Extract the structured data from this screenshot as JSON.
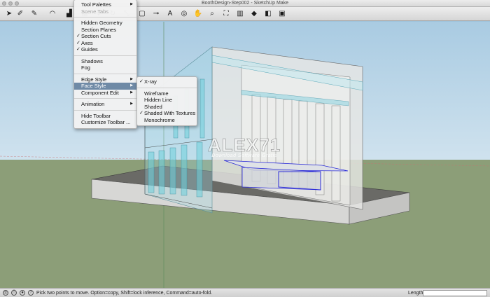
{
  "window": {
    "title": "BoothDesign-Step002 - SketchUp Make"
  },
  "toolbar": {
    "tools": [
      {
        "icon": "select-arrow-icon",
        "glyph": "➤"
      },
      {
        "icon": "eraser-icon",
        "glyph": "✐"
      },
      {
        "icon": "pencil-icon",
        "glyph": "✎"
      },
      {
        "icon": "arc-icon",
        "glyph": "◠"
      },
      {
        "icon": "paint-bucket-icon",
        "glyph": "▟"
      },
      {
        "icon": "push-pull-icon",
        "glyph": "▦"
      },
      {
        "icon": "move-icon",
        "glyph": "✥"
      },
      {
        "icon": "rotate-icon",
        "glyph": "↻"
      },
      {
        "icon": "scale-icon",
        "glyph": "⤡"
      },
      {
        "icon": "offset-icon",
        "glyph": "▢"
      },
      {
        "icon": "tape-measure-icon",
        "glyph": "⊸"
      },
      {
        "icon": "text-icon",
        "glyph": "A"
      },
      {
        "icon": "orbit-icon",
        "glyph": "◎"
      },
      {
        "icon": "pan-icon",
        "glyph": "✋"
      },
      {
        "icon": "zoom-icon",
        "glyph": "⌕"
      },
      {
        "icon": "zoom-extents-icon",
        "glyph": "⛶"
      },
      {
        "icon": "warehouse-icon",
        "glyph": "▥"
      },
      {
        "icon": "extension-warehouse-icon",
        "glyph": "◆"
      },
      {
        "icon": "section-plane-icon",
        "glyph": "◧"
      },
      {
        "icon": "model-info-icon",
        "glyph": "▣"
      }
    ]
  },
  "view_menu": {
    "items": [
      {
        "label": "Tool Palettes",
        "checked": false,
        "submenu": true,
        "disabled": false
      },
      {
        "label": "Scene Tabs",
        "checked": false,
        "submenu": false,
        "disabled": true
      },
      {
        "sep": true
      },
      {
        "label": "Hidden Geometry",
        "checked": false,
        "submenu": false,
        "disabled": false
      },
      {
        "label": "Section Planes",
        "checked": false,
        "submenu": false,
        "disabled": false
      },
      {
        "label": "Section Cuts",
        "checked": true,
        "submenu": false,
        "disabled": false
      },
      {
        "label": "Axes",
        "checked": true,
        "submenu": false,
        "disabled": false
      },
      {
        "label": "Guides",
        "checked": true,
        "submenu": false,
        "disabled": false
      },
      {
        "sep": true
      },
      {
        "label": "Shadows",
        "checked": false,
        "submenu": false,
        "disabled": false
      },
      {
        "label": "Fog",
        "checked": false,
        "submenu": false,
        "disabled": false
      },
      {
        "sep": true
      },
      {
        "label": "Edge Style",
        "checked": false,
        "submenu": true,
        "disabled": false
      },
      {
        "label": "Face Style",
        "checked": false,
        "submenu": true,
        "disabled": false,
        "highlight": true
      },
      {
        "label": "Component Edit",
        "checked": false,
        "submenu": true,
        "disabled": false
      },
      {
        "sep": true
      },
      {
        "label": "Animation",
        "checked": false,
        "submenu": true,
        "disabled": false
      },
      {
        "sep": true
      },
      {
        "label": "Hide Toolbar",
        "checked": false,
        "submenu": false,
        "disabled": false
      },
      {
        "label": "Customize Toolbar ...",
        "checked": false,
        "submenu": false,
        "disabled": false
      }
    ]
  },
  "face_style_menu": {
    "items": [
      {
        "label": "X-ray",
        "checked": true
      },
      {
        "sep": true
      },
      {
        "label": "Wireframe",
        "checked": false
      },
      {
        "label": "Hidden Line",
        "checked": false
      },
      {
        "label": "Shaded",
        "checked": false
      },
      {
        "label": "Shaded With Textures",
        "checked": true
      },
      {
        "label": "Monochrome",
        "checked": false
      }
    ]
  },
  "watermark": {
    "brand": "ALEX71",
    "tagline": "Download Software Gratis"
  },
  "statusbar": {
    "message": "Pick two points to move.  Option=copy, Shift=lock inference, Command=auto-fold.",
    "length_label": "Length",
    "length_value": ""
  },
  "colors": {
    "sky": "#a9cbe2",
    "ground": "#8c9e78",
    "menu_highlight": "#6f8aa6",
    "glass": "#7fd3e0",
    "selection": "#2b2bd8"
  }
}
